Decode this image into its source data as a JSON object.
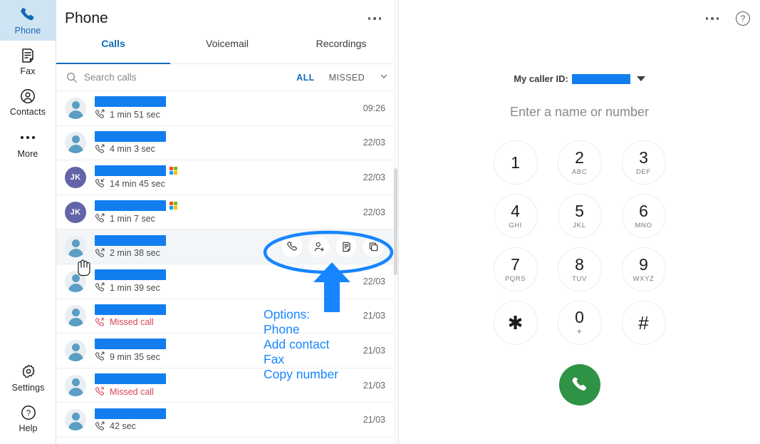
{
  "rail": {
    "items": [
      {
        "label": "Phone",
        "icon": "phone-icon",
        "active": true
      },
      {
        "label": "Fax",
        "icon": "fax-icon",
        "active": false
      },
      {
        "label": "Contacts",
        "icon": "contacts-icon",
        "active": false
      },
      {
        "label": "More",
        "icon": "ellipsis-icon",
        "active": false
      }
    ],
    "bottom": [
      {
        "label": "Settings",
        "icon": "gear-icon"
      },
      {
        "label": "Help",
        "icon": "help-icon"
      }
    ]
  },
  "panel": {
    "title": "Phone",
    "overflow_icon": "ellipsis-icon",
    "tabs": [
      {
        "label": "Calls",
        "active": true
      },
      {
        "label": "Voicemail",
        "active": false
      },
      {
        "label": "Recordings",
        "active": false
      }
    ],
    "search": {
      "placeholder": "Search calls",
      "value": "",
      "icon": "search-icon"
    },
    "filters": {
      "all": "ALL",
      "missed": "MISSED",
      "chevron": "chevron-down-icon"
    }
  },
  "calls": [
    {
      "avatar_type": "generic",
      "initials": "",
      "redact_width": 100,
      "ms_badge": false,
      "direction": "outgoing",
      "detail": "1 min 51 sec",
      "missed": false,
      "time": "09:26",
      "hovered": false
    },
    {
      "avatar_type": "generic",
      "initials": "",
      "redact_width": 100,
      "ms_badge": false,
      "direction": "outgoing",
      "detail": "4 min 3 sec",
      "missed": false,
      "time": "22/03",
      "hovered": false
    },
    {
      "avatar_type": "initials",
      "initials": "JK",
      "redact_width": 100,
      "ms_badge": true,
      "direction": "incoming",
      "detail": "14 min 45 sec",
      "missed": false,
      "time": "22/03",
      "hovered": false
    },
    {
      "avatar_type": "initials",
      "initials": "JK",
      "redact_width": 100,
      "ms_badge": true,
      "direction": "outgoing",
      "detail": "1 min 7 sec",
      "missed": false,
      "time": "22/03",
      "hovered": false
    },
    {
      "avatar_type": "generic",
      "initials": "",
      "redact_width": 100,
      "ms_badge": false,
      "direction": "outgoing",
      "detail": "2 min 38 sec",
      "missed": false,
      "time": "",
      "hovered": true
    },
    {
      "avatar_type": "generic",
      "initials": "",
      "redact_width": 100,
      "ms_badge": false,
      "direction": "outgoing",
      "detail": "1 min 39 sec",
      "missed": false,
      "time": "22/03",
      "hovered": false
    },
    {
      "avatar_type": "generic",
      "initials": "",
      "redact_width": 100,
      "ms_badge": false,
      "direction": "missed",
      "detail": "Missed call",
      "missed": true,
      "time": "21/03",
      "hovered": false
    },
    {
      "avatar_type": "generic",
      "initials": "",
      "redact_width": 100,
      "ms_badge": false,
      "direction": "outgoing",
      "detail": "9 min 35 sec",
      "missed": false,
      "time": "21/03",
      "hovered": false
    },
    {
      "avatar_type": "generic",
      "initials": "",
      "redact_width": 100,
      "ms_badge": false,
      "direction": "missed",
      "detail": "Missed call",
      "missed": true,
      "time": "21/03",
      "hovered": false
    },
    {
      "avatar_type": "generic",
      "initials": "",
      "redact_width": 100,
      "ms_badge": false,
      "direction": "outgoing",
      "detail": "42 sec",
      "missed": false,
      "time": "21/03",
      "hovered": false
    }
  ],
  "row_actions": [
    {
      "name": "phone-icon",
      "title": "Phone"
    },
    {
      "name": "add-contact-icon",
      "title": "Add contact"
    },
    {
      "name": "fax-icon",
      "title": "Fax"
    },
    {
      "name": "copy-icon",
      "title": "Copy number"
    }
  ],
  "dialpad": {
    "top_overflow_icon": "ellipsis-icon",
    "help_icon": "help-icon",
    "help_glyph": "?",
    "caller_id_label": "My caller ID:",
    "caller_id_value": "",
    "number_placeholder": "Enter a name or number",
    "number_value": "",
    "keys": [
      {
        "digit": "1",
        "sub": ""
      },
      {
        "digit": "2",
        "sub": "ABC"
      },
      {
        "digit": "3",
        "sub": "DEF"
      },
      {
        "digit": "4",
        "sub": "GHI"
      },
      {
        "digit": "5",
        "sub": "JKL"
      },
      {
        "digit": "6",
        "sub": "MNO"
      },
      {
        "digit": "7",
        "sub": "PQRS"
      },
      {
        "digit": "8",
        "sub": "TUV"
      },
      {
        "digit": "9",
        "sub": "WXYZ"
      },
      {
        "digit": "✱",
        "sub": ""
      },
      {
        "digit": "0",
        "sub": "+"
      },
      {
        "digit": "#",
        "sub": ""
      }
    ],
    "call_button_icon": "phone-icon"
  },
  "annotation": {
    "color": "#1785ff",
    "lines": [
      "Options:",
      "Phone",
      "Add contact",
      "Fax",
      "Copy number"
    ],
    "ellipse": "highlight-ellipse",
    "arrow": "pointer-arrow"
  }
}
